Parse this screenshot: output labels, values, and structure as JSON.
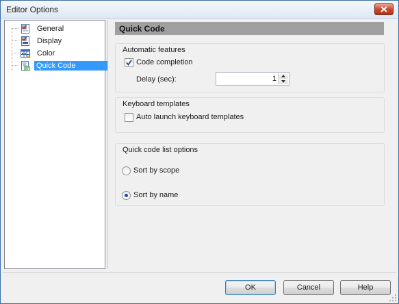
{
  "window": {
    "title": "Editor Options"
  },
  "tree": {
    "items": [
      {
        "label": "General",
        "icon": "general-page-icon"
      },
      {
        "label": "Display",
        "icon": "display-page-icon"
      },
      {
        "label": "Color",
        "icon": "color-grid-icon"
      },
      {
        "label": "Quick Code",
        "icon": "quick-code-icon",
        "selected": true
      }
    ]
  },
  "main": {
    "header": "Quick Code",
    "automatic_features": {
      "title": "Automatic features",
      "code_completion": {
        "label": "Code completion",
        "checked": true
      },
      "delay": {
        "label": "Delay (sec):",
        "value": "1"
      }
    },
    "keyboard_templates": {
      "title": "Keyboard templates",
      "auto_launch": {
        "label": "Auto launch keyboard templates",
        "checked": false
      }
    },
    "quick_code_list": {
      "title": "Quick code list options",
      "sort_by_scope": {
        "label": "Sort by scope",
        "selected": false
      },
      "sort_by_name": {
        "label": "Sort by name",
        "selected": true
      }
    }
  },
  "footer": {
    "ok": "OK",
    "cancel": "Cancel",
    "help": "Help"
  },
  "colors": {
    "selection": "#3399ff",
    "header_bg": "#a0a0a0",
    "dialog_bg": "#f0f0f0"
  }
}
